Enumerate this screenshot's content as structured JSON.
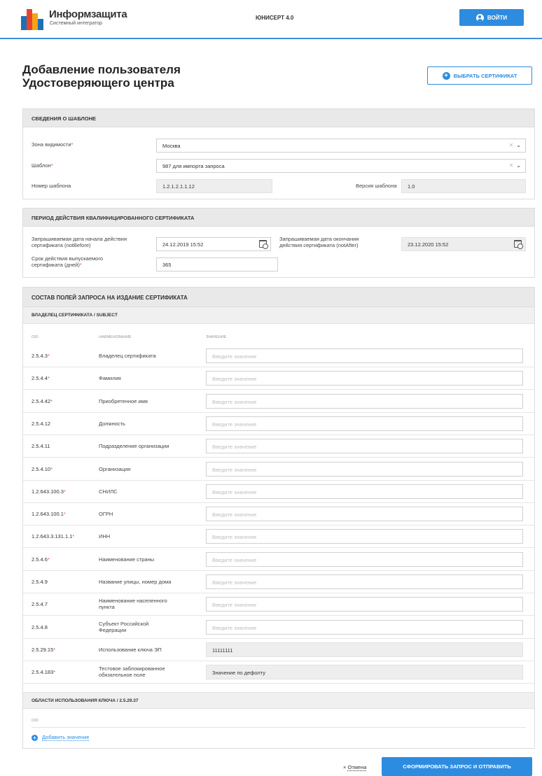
{
  "header": {
    "logo_name": "Информзащита",
    "logo_sub": "Системный интегратор",
    "app_name": "ЮНИСЕРТ 4.0",
    "login_label": "ВОЙТИ"
  },
  "page": {
    "title_line1": "Добавление пользователя",
    "title_line2": "Удостоверяющего центра",
    "choose_cert_label": "ВЫБРАТЬ СЕРТИФИКАТ"
  },
  "template_section": {
    "title": "СВЕДЕНИЯ О ШАБЛОНЕ",
    "zone_label": "Зона видимости",
    "zone_value": "Москва",
    "template_label": "Шаблон",
    "template_value": "987 для импорта запроса",
    "number_label": "Номер шаблона",
    "number_value": "1.2.1.2.1.1.12",
    "version_label": "Версия шаблона",
    "version_value": "1.0"
  },
  "period_section": {
    "title": "ПЕРИОД ДЕЙСТВИЯ КВАЛИФИЦИРОВАННОГО СЕРТИФИКАТА",
    "start_label_1": "Запрашиваемая дата начала действия",
    "start_label_2": "сертификата (notBefore)",
    "start_value": "24.12.2019 15:52",
    "end_label_1": "Запрашиваемая дата окончания",
    "end_label_2": "действия сертификата (notAfter)",
    "end_value": "23.12.2020 15:52",
    "days_label_1": "Срок действия выпускаемого",
    "days_label_2": "сертификата (дней)",
    "days_value": "365"
  },
  "request_section": {
    "title": "СОСТАВ ПОЛЕЙ ЗАПРОСА НА ИЗДАНИЕ СЕРТИФИКАТА",
    "subject_head": "ВЛАДЕЛЕЦ СЕРТИФИКАТА / SUBJECT",
    "col_oid": "OID",
    "col_name": "НАИМЕНОВАНИЕ",
    "col_value": "ЗНАЧЕНИЕ",
    "placeholder": "Введите значение",
    "rows": [
      {
        "oid": "2.5.4.3",
        "name": "Владелец сертификата",
        "value": ""
      },
      {
        "oid": "2.5.4.4",
        "name": "Фамилия",
        "value": ""
      },
      {
        "oid": "2.5.4.42",
        "name": "Приобретенное имя",
        "value": ""
      },
      {
        "oid": "2.5.4.12",
        "name": "Должность",
        "value": ""
      },
      {
        "oid": "2.5.4.11",
        "name": "Подразделение организации",
        "value": ""
      },
      {
        "oid": "2.5.4.10",
        "name": "Организация",
        "value": ""
      },
      {
        "oid": "1.2.643.100.3",
        "name": "СНИЛС",
        "value": ""
      },
      {
        "oid": "1.2.643.100.1",
        "name": "ОГРН",
        "value": ""
      },
      {
        "oid": "1.2.643.3.131.1.1",
        "name": "ИНН",
        "value": ""
      },
      {
        "oid": "2.5.4.6",
        "name": "Наименование страны",
        "value": ""
      },
      {
        "oid": "2.5.4.9",
        "name": "Название улицы, номер дома",
        "value": ""
      },
      {
        "oid": "2.5.4.7",
        "name_1": "Наименование населенного",
        "name_2": "пункта",
        "value": ""
      },
      {
        "oid": "2.5.4.8",
        "name_1": "Субъект Российской",
        "name_2": "Федерации",
        "value": ""
      },
      {
        "oid": "2.5.29.15",
        "name": "Использование ключа ЭП",
        "value": "11111111"
      },
      {
        "oid": "2.5.4.183",
        "name_1": "Тестовое заблокированное",
        "name_2": "обязательное поле",
        "value": "Значение по дефолту"
      }
    ],
    "key_usage_head": "ОБЛАСТИ ИСПОЛЬЗОВАНИЯ КЛЮЧА / 2.5.29.37",
    "key_usage_col_oid": "OID",
    "add_value_label": "Добавить значение"
  },
  "footer": {
    "cancel_prefix": "×",
    "cancel_label": "Отмена",
    "submit_label": "СФОРМИРОВАТЬ ЗАПРОС И ОТПРАВИТЬ"
  },
  "colors": {
    "accent": "#2d8ce0",
    "required": "#d9534f"
  }
}
